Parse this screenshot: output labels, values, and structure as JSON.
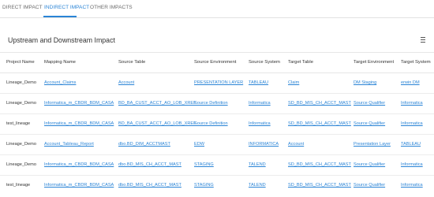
{
  "tabs": [
    {
      "label": "DIRECT IMPACT",
      "active": false
    },
    {
      "label": "INDIRECT IMPACT",
      "active": true
    },
    {
      "label": "OTHER IMPACTS",
      "active": false
    }
  ],
  "panel": {
    "title": "Upstream and Downstream Impact",
    "menu_icon": "hamburger-icon"
  },
  "columns": [
    "Project Name",
    "Mapping Name",
    "Source Table",
    "Source Environment",
    "Source System",
    "Target Table",
    "Target Environment",
    "Target System"
  ],
  "rows": [
    [
      "Lineage_Demo",
      "Account_Claims",
      "Account",
      "PRESENTATION LAYER",
      "TABLEAU",
      "Claim",
      "DM Staging",
      "erwin DM"
    ],
    [
      "Lineage_Demo",
      "Informatica_m_CBDR_BDM_CASA",
      "BD_BA_CUST_ACCT_AO_LOB_XREF",
      "Source Definition",
      "Informatica",
      "SD_BD_MIS_CH_ACCT_MAST",
      "Source Qualifier",
      "Informatica"
    ],
    [
      "test_lineage",
      "Informatica_m_CBDR_BDM_CASA",
      "BD_BA_CUST_ACCT_AO_LOB_XREF",
      "Source Definition",
      "Informatica",
      "SD_BD_MIS_CH_ACCT_MAST",
      "Source Qualifier",
      "Informatica"
    ],
    [
      "Lineage_Demo",
      "Account_Tableau_Report",
      "dbo.BD_DIM_ACCTMAST",
      "EDW",
      "INFORMATICA",
      "Account",
      "Presentation Layer",
      "TABLEAU"
    ],
    [
      "Lineage_Demo",
      "Informatica_m_CBDR_BDM_CASA",
      "dbo.BD_MIS_CH_ACCT_MAST",
      "STAGING",
      "TALEND",
      "SD_BD_MIS_CH_ACCT_MAST",
      "Source Qualifier",
      "Informatica"
    ],
    [
      "test_lineage",
      "Informatica_m_CBDR_BDM_CASA",
      "dbo.BD_MIS_CH_ACCT_MAST",
      "STAGING",
      "TALEND",
      "SD_BD_MIS_CH_ACCT_MAST",
      "Source Qualifier",
      "Informatica"
    ]
  ],
  "colors": {
    "accent": "#2a84d6",
    "text": "#333333",
    "muted": "#6b6b6b"
  }
}
